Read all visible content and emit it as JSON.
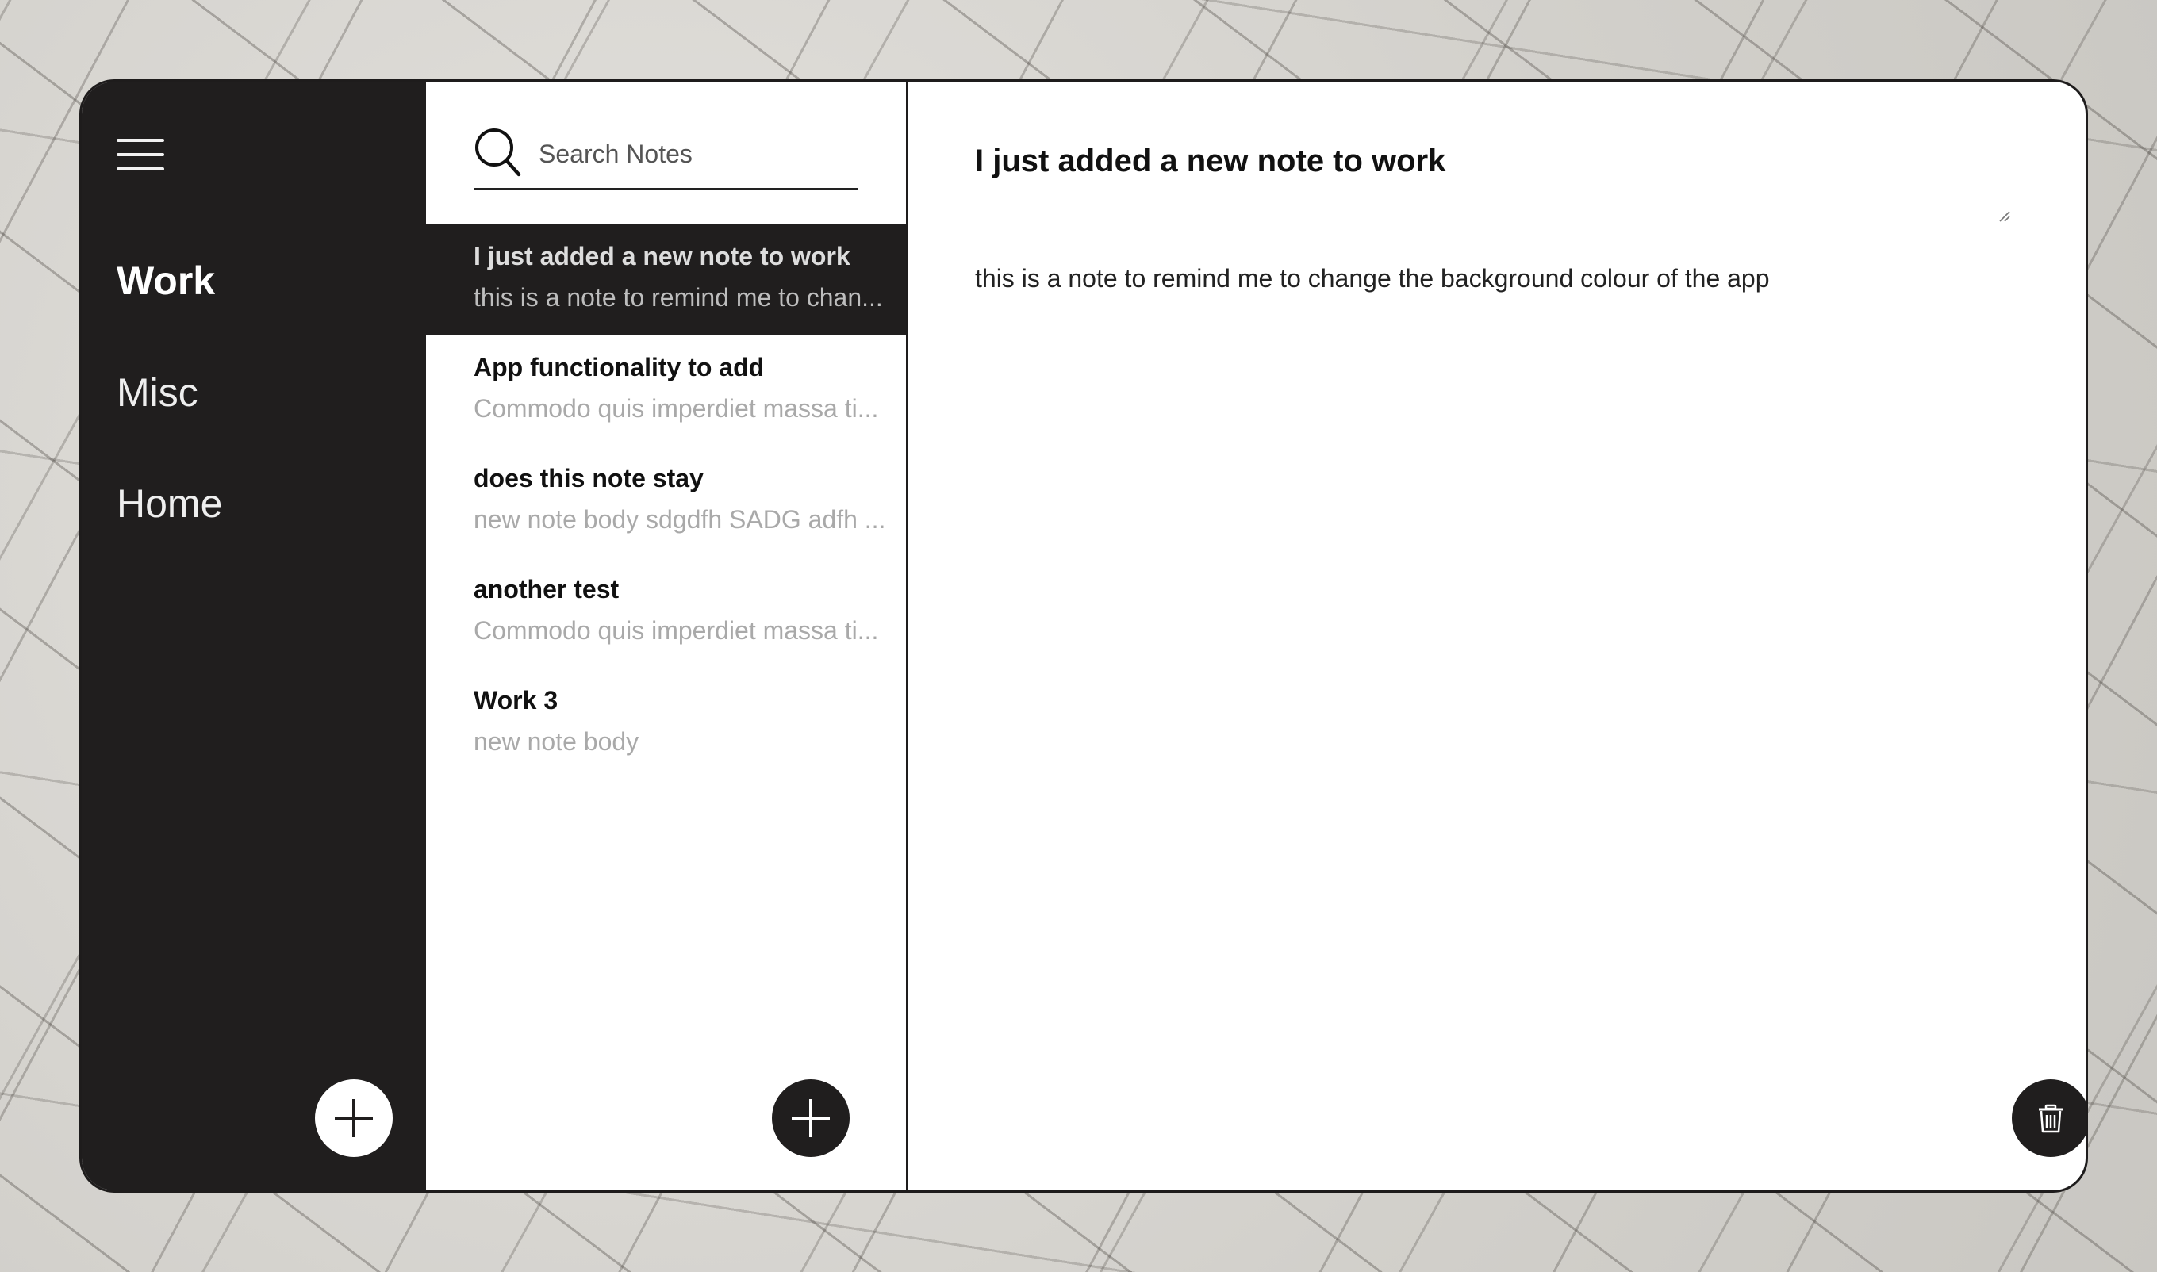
{
  "sidebar": {
    "menu_icon": "hamburger-menu-icon",
    "categories": [
      {
        "label": "Work",
        "active": true
      },
      {
        "label": "Misc",
        "active": false
      },
      {
        "label": "Home",
        "active": false
      }
    ],
    "add_category_icon": "plus-icon"
  },
  "search": {
    "icon": "search-icon",
    "placeholder": "Search Notes",
    "value": ""
  },
  "notes": [
    {
      "title": "I just added a new note to work",
      "preview": "this is a note to remind me to chan...",
      "active": true
    },
    {
      "title": "App functionality to add",
      "preview": "Commodo quis imperdiet massa ti...",
      "active": false
    },
    {
      "title": "does this note stay",
      "preview": "new note body sdgdfh SADG adfh ...",
      "active": false
    },
    {
      "title": "another test",
      "preview": "Commodo quis imperdiet massa ti...",
      "active": false
    },
    {
      "title": "Work 3",
      "preview": "new note body",
      "active": false
    }
  ],
  "add_note_icon": "plus-icon",
  "editor": {
    "title": "I just added a new note to work",
    "body": "this is a note to remind me to change the background colour of the app",
    "delete_icon": "trash-icon"
  },
  "colors": {
    "sidebar_bg": "#201e1e",
    "accent_dark": "#201e1e",
    "preview_text": "#a9a9a9"
  }
}
